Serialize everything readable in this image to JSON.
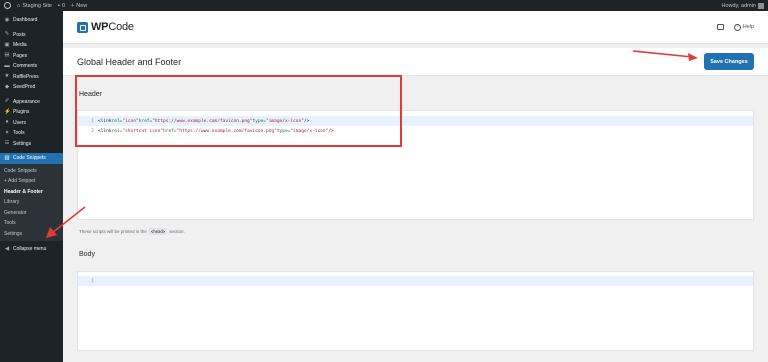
{
  "admin_bar": {
    "site_name": "Staging Site",
    "comments_count": "0",
    "new_label": "New",
    "howdy": "Howdy, admin"
  },
  "sidebar": {
    "items": [
      {
        "label": "Dashboard",
        "icon": "dashboard-icon"
      },
      {
        "label": "Posts",
        "icon": "pin-icon"
      },
      {
        "label": "Media",
        "icon": "media-icon"
      },
      {
        "label": "Pages",
        "icon": "page-icon"
      },
      {
        "label": "Comments",
        "icon": "comment-icon"
      },
      {
        "label": "RafflePress",
        "icon": "raffle-icon"
      },
      {
        "label": "SeedProd",
        "icon": "seed-icon"
      },
      {
        "label": "Appearance",
        "icon": "brush-icon"
      },
      {
        "label": "Plugins",
        "icon": "plugin-icon"
      },
      {
        "label": "Users",
        "icon": "user-icon"
      },
      {
        "label": "Tools",
        "icon": "wrench-icon"
      },
      {
        "label": "Settings",
        "icon": "settings-icon"
      },
      {
        "label": "Code Snippets",
        "icon": "code-icon"
      }
    ],
    "submenu": [
      "Code Snippets",
      "+ Add Snippet",
      "Header & Footer",
      "Library",
      "Generator",
      "Tools",
      "Settings"
    ],
    "collapse_label": "Collapse menu"
  },
  "plugin_header": {
    "logo_prefix": "WP",
    "logo_suffix": "Code",
    "help_label": "Help"
  },
  "page": {
    "title": "Global Header and Footer",
    "save_label": "Save Changes"
  },
  "header_section": {
    "title": "Header",
    "line_numbers": [
      "1",
      "2"
    ],
    "lines": [
      {
        "tag_open": "<link ",
        "a1": "rel=",
        "v1": "\"icon\"",
        "a2": " href=",
        "v2": "\"https://www.example.com/favicon.png\"",
        "a3": " type=",
        "v3": "\"image/x-icon\"",
        "tag_close": " />"
      },
      {
        "tag_open": "<link ",
        "a1": "rel=",
        "v1": "\"shortcut icon\"",
        "a2": " href=",
        "v2": "\"https://www.example.com/favicon.png\"",
        "a3": " type=",
        "v3": "\"image/x-icon\"",
        "tag_close": " />"
      }
    ],
    "note_before": "These scripts will be printed in the",
    "note_code": "<head>",
    "note_after": "section."
  },
  "body_section": {
    "title": "Body",
    "line_numbers": [
      "1"
    ]
  },
  "colors": {
    "accent": "#2271b1",
    "annotation": "#e53935",
    "admin_bg": "#1d2327"
  }
}
